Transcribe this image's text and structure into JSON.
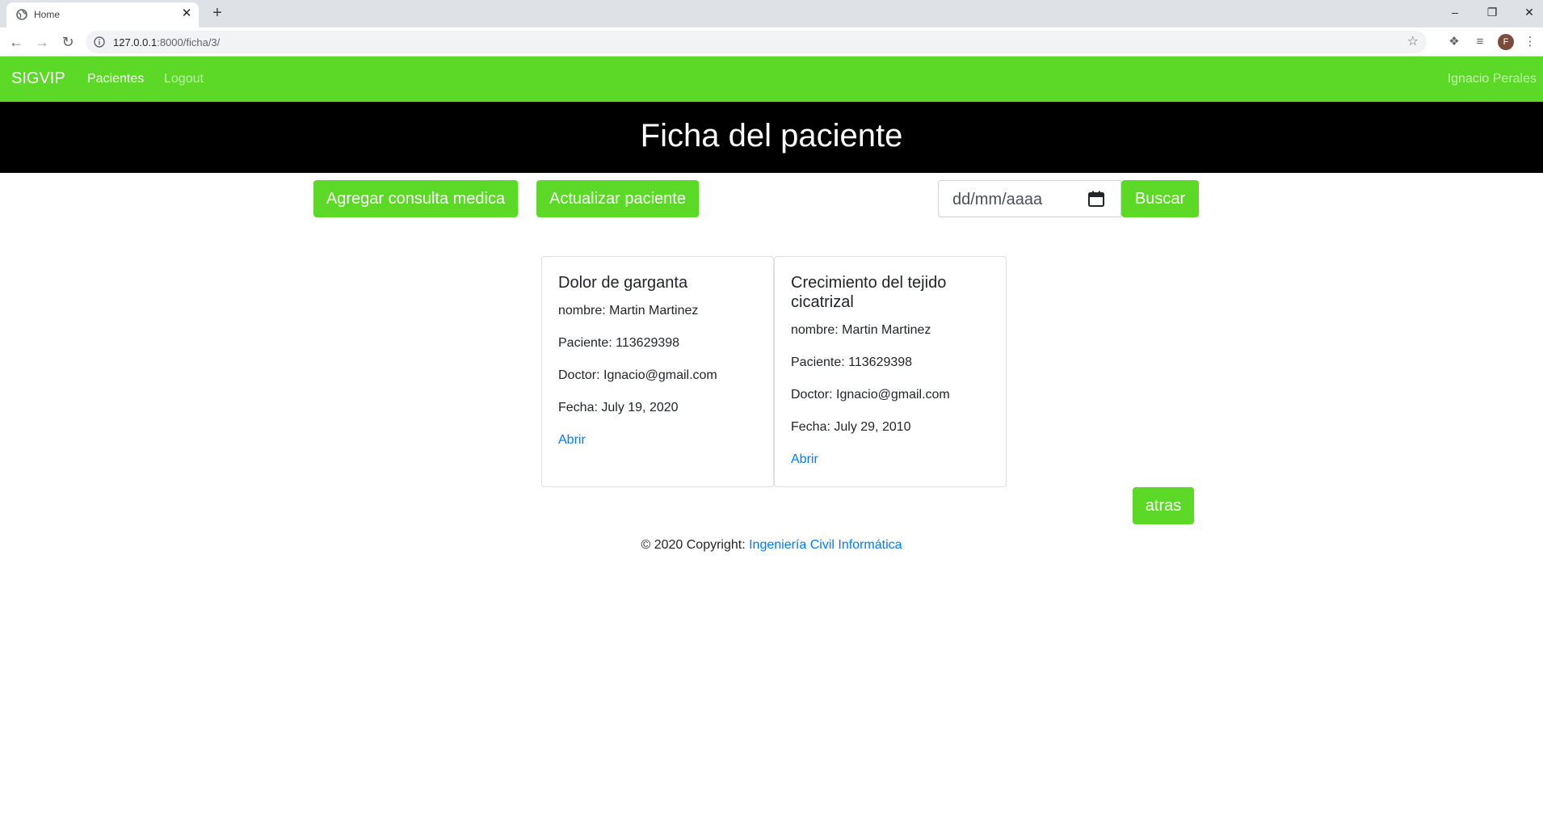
{
  "browser": {
    "tab_title": "Home",
    "tab_close": "✕",
    "new_tab": "+",
    "url_host": "127.0.0.1",
    "url_path": ":8000/ficha/3/",
    "profile_initial": "F",
    "window_controls": {
      "minimize": "–",
      "restore": "❐",
      "close": "✕"
    }
  },
  "navbar": {
    "brand": "SIGVIP",
    "links": [
      "Pacientes",
      "Logout"
    ],
    "user": "Ignacio Perales"
  },
  "hero": {
    "title": "Ficha del paciente"
  },
  "actions": {
    "agregar": "Agregar consulta medica",
    "actualizar": "Actualizar paciente",
    "date_placeholder": "dd/mm/aaaa",
    "buscar": "Buscar"
  },
  "cards": [
    {
      "title": "Dolor de garganta",
      "nombre": "nombre: Martin Martinez",
      "paciente": "Paciente: 113629398",
      "doctor": "Doctor: Ignacio@gmail.com",
      "fecha": "Fecha: July 19, 2020",
      "link": "Abrir"
    },
    {
      "title": "Crecimiento del tejido cicatrizal",
      "nombre": "nombre: Martin Martinez",
      "paciente": "Paciente: 113629398",
      "doctor": "Doctor: Ignacio@gmail.com",
      "fecha": "Fecha: July 29, 2010",
      "link": "Abrir"
    }
  ],
  "back_button": "atras",
  "footer": {
    "text": "© 2020 Copyright: ",
    "link": "Ingeniería Civil Informática"
  },
  "colors": {
    "navbar_green": "#5cd826",
    "hero_black": "#000000",
    "link_blue": "#007bff"
  },
  "icons": [
    "globe-icon",
    "close-icon",
    "plus-icon",
    "back-icon",
    "forward-icon",
    "reload-icon",
    "info-icon",
    "star-icon",
    "puzzle-icon",
    "media-icon",
    "menu-icon",
    "calendar-icon"
  ]
}
